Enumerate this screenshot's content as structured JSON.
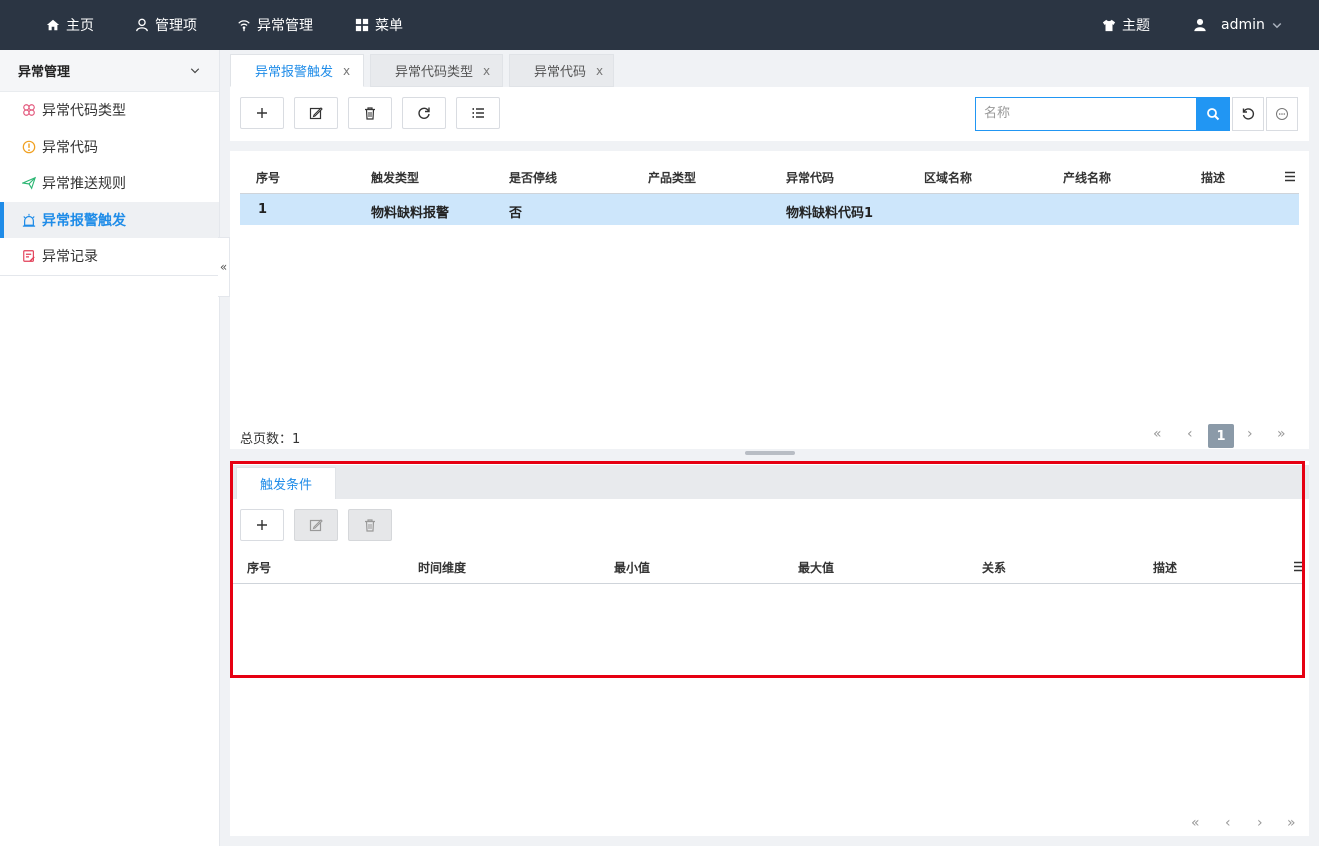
{
  "topnav": {
    "items": [
      {
        "label": "主页",
        "icon": "home-icon"
      },
      {
        "label": "管理项",
        "icon": "user-icon"
      },
      {
        "label": "异常管理",
        "icon": "signal-icon"
      },
      {
        "label": "菜单",
        "icon": "grid-icon"
      }
    ],
    "theme_label": "主题",
    "user_label": "admin"
  },
  "sidebar": {
    "title": "异常管理",
    "items": [
      {
        "label": "异常代码类型",
        "icon": "flower-icon",
        "color": "#e2557a"
      },
      {
        "label": "异常代码",
        "icon": "warning-circle-icon",
        "color": "#f0a020"
      },
      {
        "label": "异常推送规则",
        "icon": "send-icon",
        "color": "#2bb673"
      },
      {
        "label": "异常报警触发",
        "icon": "alarm-icon",
        "color": "#1f8ce8"
      },
      {
        "label": "异常记录",
        "icon": "record-icon",
        "color": "#e23e57"
      }
    ],
    "collapse_glyph": "«"
  },
  "tabs": [
    {
      "label": "异常报警触发",
      "close": "x"
    },
    {
      "label": "异常代码类型",
      "close": "x"
    },
    {
      "label": "异常代码",
      "close": "x"
    }
  ],
  "search": {
    "placeholder": "名称"
  },
  "main_table": {
    "headers": [
      "序号",
      "触发类型",
      "是否停线",
      "产品类型",
      "异常代码",
      "区域名称",
      "产线名称",
      "描述"
    ],
    "rows": [
      [
        "1",
        "物料缺料报警",
        "否",
        "",
        "物料缺料代码1",
        "",
        "",
        ""
      ]
    ],
    "total_label": "总页数：1",
    "current_page": "1"
  },
  "detail": {
    "tab_label": "触发条件",
    "headers": [
      "序号",
      "时间维度",
      "最小值",
      "最大值",
      "关系",
      "描述"
    ]
  },
  "pager": {
    "first": "«",
    "prev": "‹",
    "next": "›",
    "last": "»"
  },
  "colors": {
    "nav_bg": "#2b3543",
    "accent": "#1f8ce8",
    "selected_row": "#cde6fb",
    "highlight_box": "#e60012"
  }
}
